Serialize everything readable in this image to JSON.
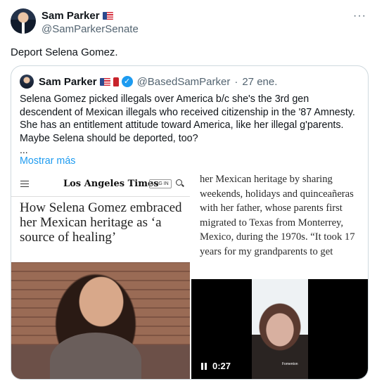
{
  "author": {
    "display_name": "Sam Parker",
    "handle": "@SamParkerSenate",
    "flag_icon": "us-flag-icon"
  },
  "more_icon_glyph": "···",
  "tweet": {
    "text": "Deport Selena Gomez."
  },
  "quoted_tweet": {
    "display_name": "Sam Parker",
    "handle": "@BasedSamParker",
    "separator": "·",
    "date": "27 ene.",
    "verified_glyph": "✓",
    "body": "Selena Gomez picked illegals over America b/c she's the 3rd gen descendent of Mexican illegals who received citizenship in the '87 Amnesty. She has an entitlement attitude toward America, like her illegal g'parents. Maybe Selena should be deported, too?",
    "ellipsis": "...",
    "show_more": "Mostrar más",
    "accent_color": "#1d9bf0"
  },
  "media": {
    "lat_logo": "Los Angeles Times",
    "login_label": "LOG IN",
    "headline": "How Selena Gomez embraced her Mexican heritage as ‘a source of healing’",
    "article_excerpt": "her Mexican heritage by sharing weekends, holidays and quinceañeras with her father, whose parents first migrated to Texas from Monterrey, Mexico, during the 1970s. “It took 17 years for my grandparents to get",
    "video_caption": "Fomenton",
    "video_time": "0:27"
  }
}
